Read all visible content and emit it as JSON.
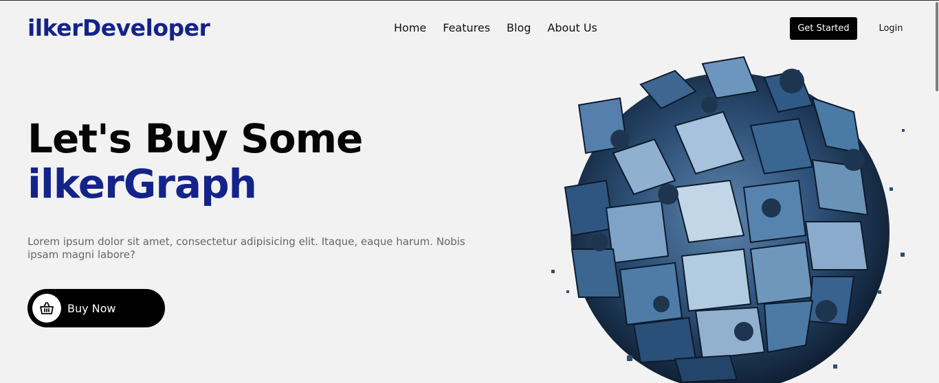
{
  "header": {
    "logo": "ilkerDeveloper",
    "nav": [
      "Home",
      "Features",
      "Blog",
      "About Us"
    ],
    "get_started_label": "Get Started",
    "login_label": "Login"
  },
  "hero": {
    "title_line1": "Let's Buy Some",
    "title_line2": "ilkerGraph",
    "description": "Lorem ipsum dolor sit amet, consectetur adipisicing elit. Itaque, eaque harum. Nobis ipsam magni labore?",
    "buy_button_label": "Buy Now",
    "buy_icon": "basket-icon",
    "image": "abstract-cube-sphere-illustration"
  },
  "colors": {
    "background": "#f2f2f2",
    "brand": "#14238a",
    "button_bg": "#000000",
    "text": "#111111",
    "muted": "#666666"
  }
}
